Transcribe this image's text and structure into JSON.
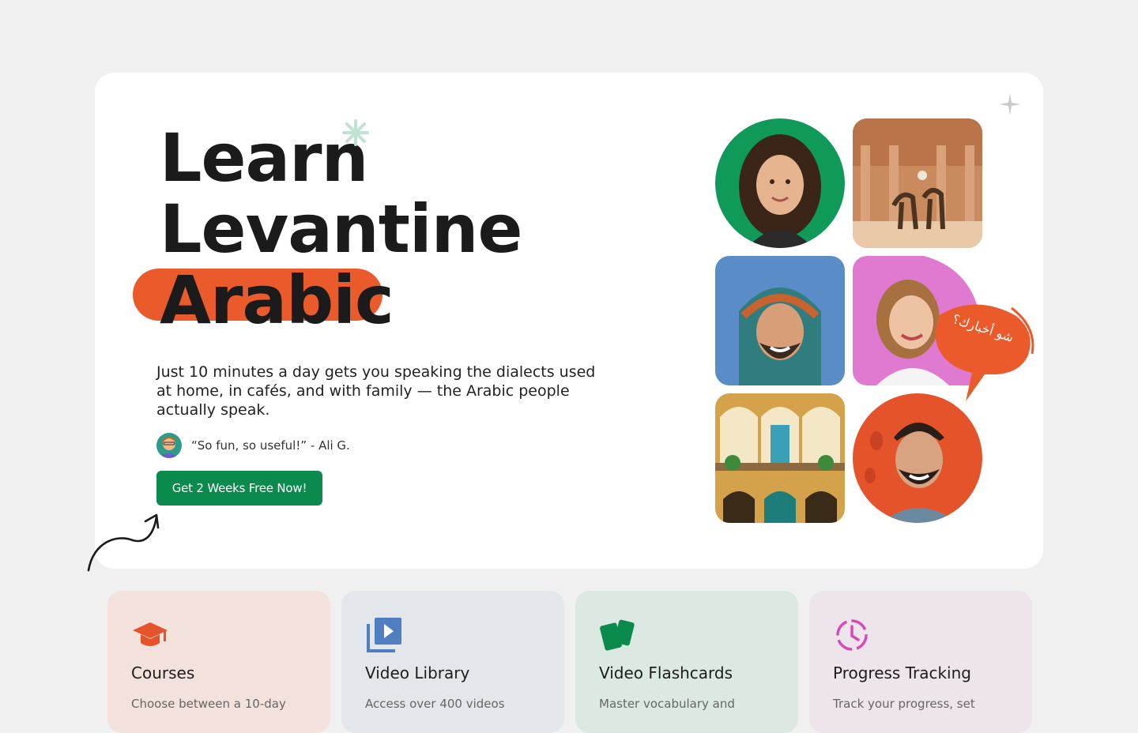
{
  "hero": {
    "title_line1": "Learn",
    "title_line2": "Levantine",
    "title_line3": "Arabic",
    "subtitle": "Just 10 minutes a day gets you speaking the dialects used at home, in cafés, and with family — the Arabic people actually speak.",
    "testimonial": "“So fun, so useful!” - Ali G.",
    "cta_label": "Get 2 Weeks Free Now!",
    "speech_bubble": "شو أخبارك؟"
  },
  "colors": {
    "accent_orange": "#ea5a2b",
    "brand_green": "#0b8a4e",
    "pink": "#e07ad0",
    "sky_blue": "#4f7fc0"
  },
  "features": [
    {
      "icon": "graduation-cap-icon",
      "title": "Courses",
      "description": "Choose between a 10-day"
    },
    {
      "icon": "video-library-icon",
      "title": "Video Library",
      "description": "Access over 400 videos"
    },
    {
      "icon": "flashcards-icon",
      "title": "Video Flashcards",
      "description": "Master vocabulary and"
    },
    {
      "icon": "progress-clock-icon",
      "title": "Progress Tracking",
      "description": "Track your progress, set"
    }
  ]
}
